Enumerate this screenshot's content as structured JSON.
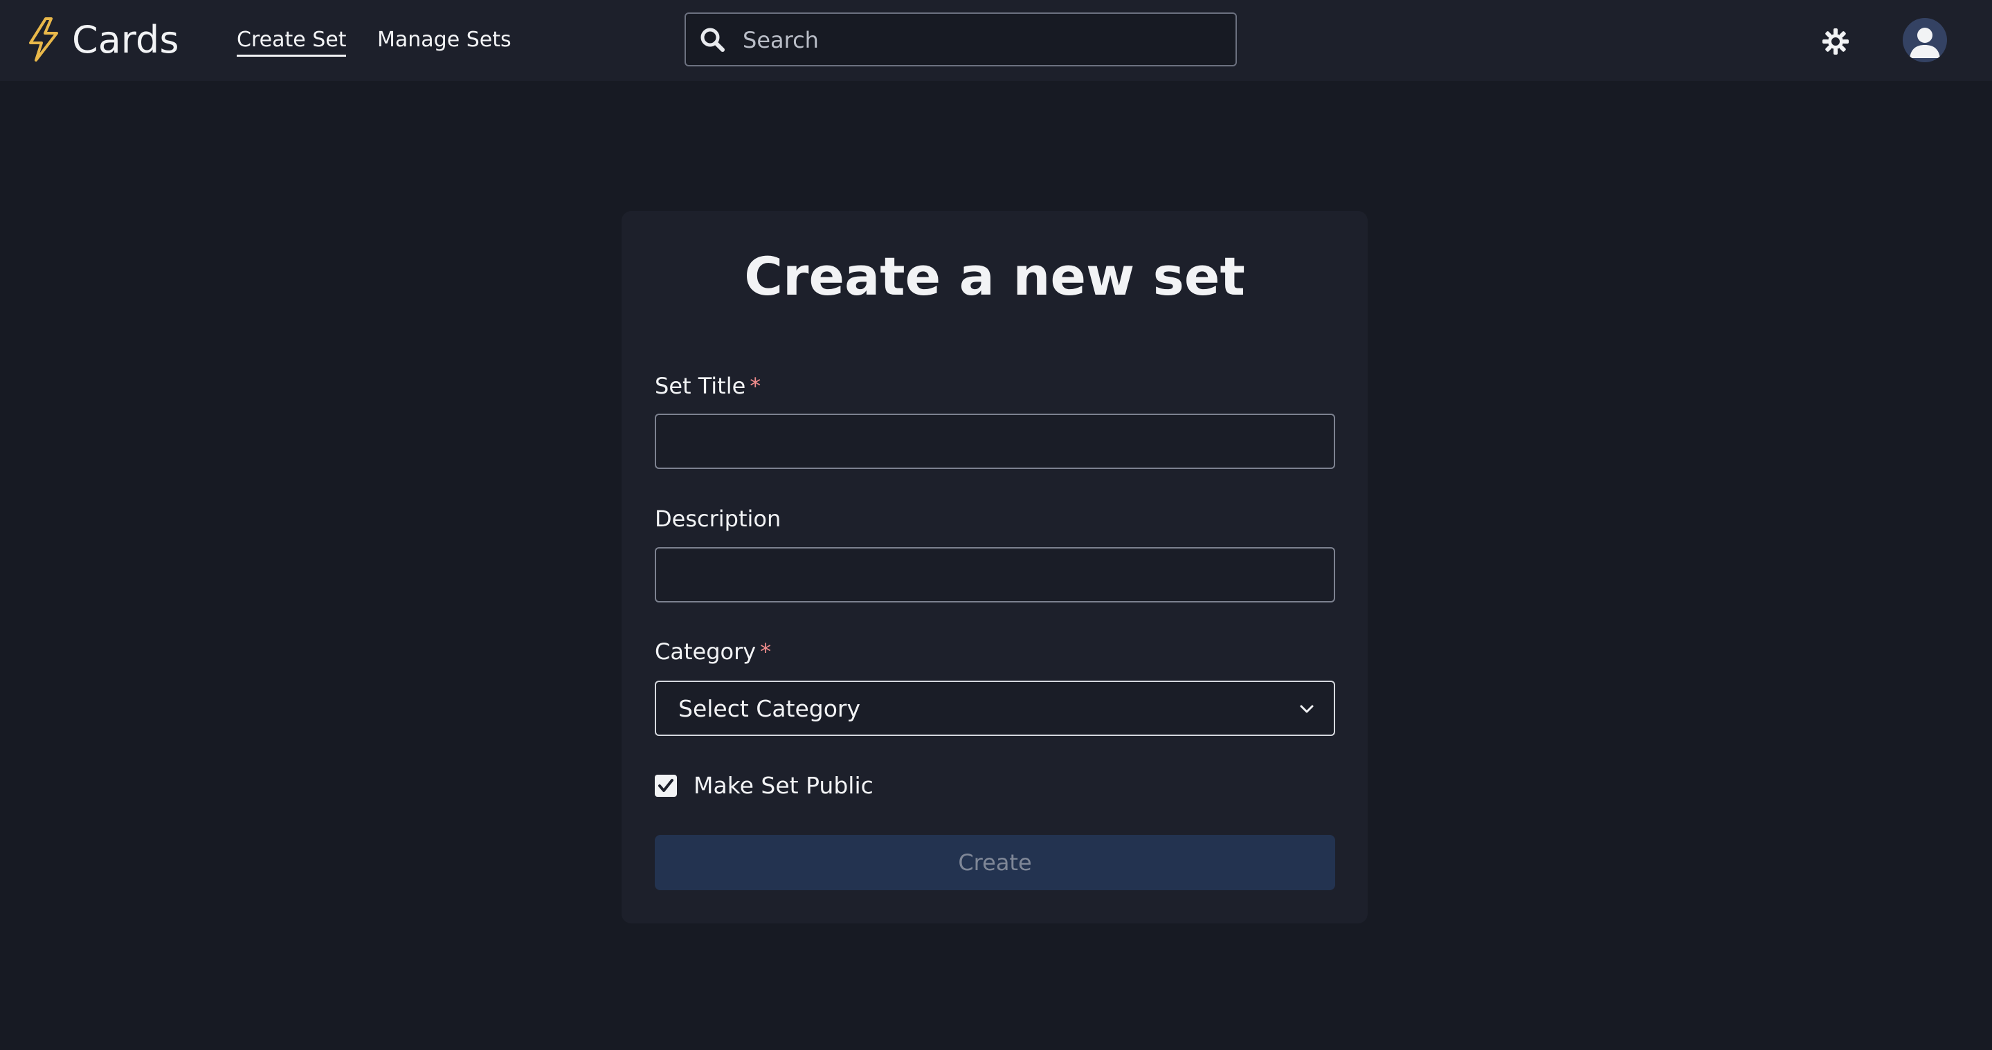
{
  "app": {
    "name": "Cards",
    "accent_color": "#e9b84a"
  },
  "nav": {
    "items": [
      {
        "label": "Create Set",
        "active": true
      },
      {
        "label": "Manage Sets",
        "active": false
      }
    ]
  },
  "search": {
    "placeholder": "Search",
    "value": ""
  },
  "header_icons": {
    "theme_toggle": "sun-icon",
    "profile": "user-avatar-icon"
  },
  "form": {
    "title": "Create a new set",
    "required_marker": "*",
    "set_title": {
      "label": "Set Title",
      "value": "",
      "required": true
    },
    "description": {
      "label": "Description",
      "value": "",
      "required": false
    },
    "category": {
      "label": "Category",
      "selected": "Select Category",
      "required": true
    },
    "make_public": {
      "label": "Make Set Public",
      "checked": true
    },
    "submit_label": "Create"
  },
  "colors": {
    "page_bg": "#171a23",
    "surface": "#1d202b",
    "required": "#f08c8c",
    "button_bg": "#233350",
    "button_text": "#7f8797"
  }
}
